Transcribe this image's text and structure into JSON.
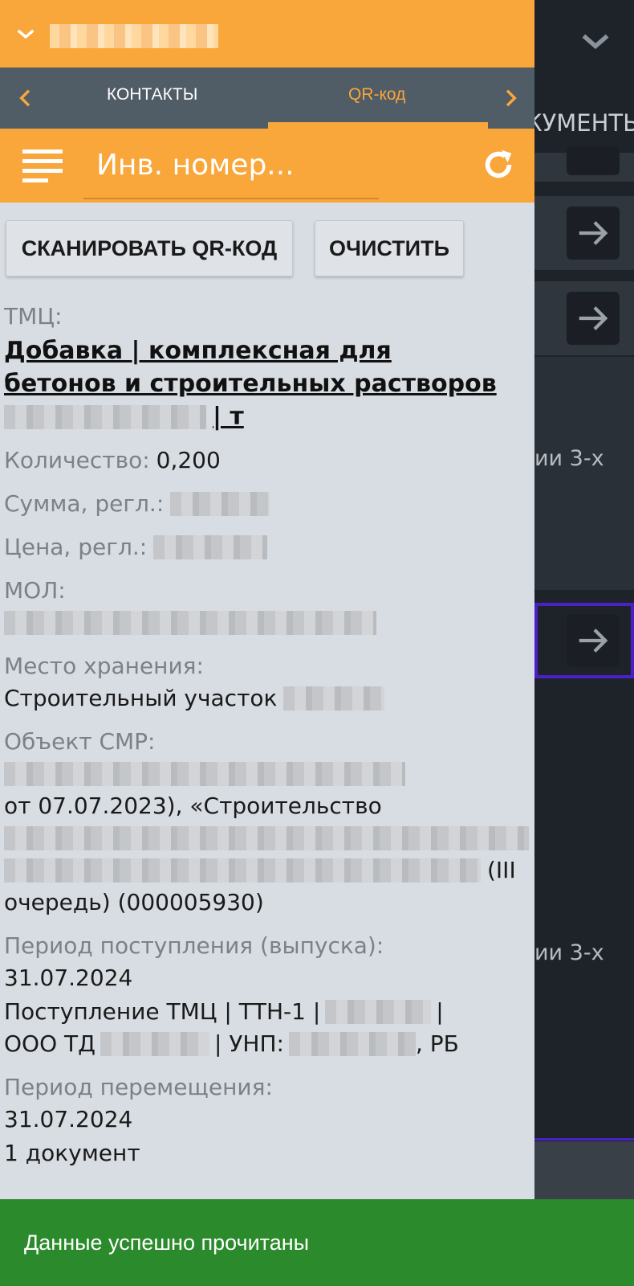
{
  "colors": {
    "accent": "#f9a63a",
    "tab_bar": "#505c66",
    "panel_bg": "#d8dde3",
    "toast_bg": "#2b8a2b",
    "bg_highlight": "#4a20c9"
  },
  "background": {
    "tab_text": "КУМЕНТЫ",
    "card_snippets": [
      "ии 3-х",
      "ии 3-х"
    ]
  },
  "tabs": {
    "items": [
      {
        "label": "КОНТАКТЫ",
        "active": false
      },
      {
        "label": "QR-код",
        "active": true
      }
    ]
  },
  "search": {
    "placeholder": "Инв. номер..."
  },
  "buttons": {
    "scan": "СКАНИРОВАТЬ QR-КОД",
    "clear": "ОЧИСТИТЬ"
  },
  "details": {
    "tmc_label": "ТМЦ:",
    "tmc_line1": "Добавка | комплексная для",
    "tmc_line2": "бетонов и строительных растворов",
    "tmc_suffix": "| т",
    "qty_label": "Количество:",
    "qty_value": "0,200",
    "sum_label": "Сумма, регл.:",
    "price_label": "Цена, регл.:",
    "mol_label": "МОЛ:",
    "storage_label": "Место хранения:",
    "storage_value": "Строительный участок",
    "object_label": "Объект СМР:",
    "object_line2": "от 07.07.2023), «Строительство",
    "object_line4_suffix": "(III",
    "object_line5": "очередь) (000005930)",
    "receipt_period_label": "Период поступления (выпуска):",
    "receipt_date": "31.07.2024",
    "receipt_doc_prefix": "Поступление ТМЦ | ТТН-1 |",
    "receipt_doc_sep": "|",
    "receipt_org_prefix": "ООО ТД",
    "receipt_unp": "| УНП:",
    "receipt_country": ", РБ",
    "transfer_period_label": "Период перемещения:",
    "transfer_date": "31.07.2024",
    "transfer_docs": "1 документ"
  },
  "toast": {
    "message": "Данные успешно прочитаны"
  }
}
